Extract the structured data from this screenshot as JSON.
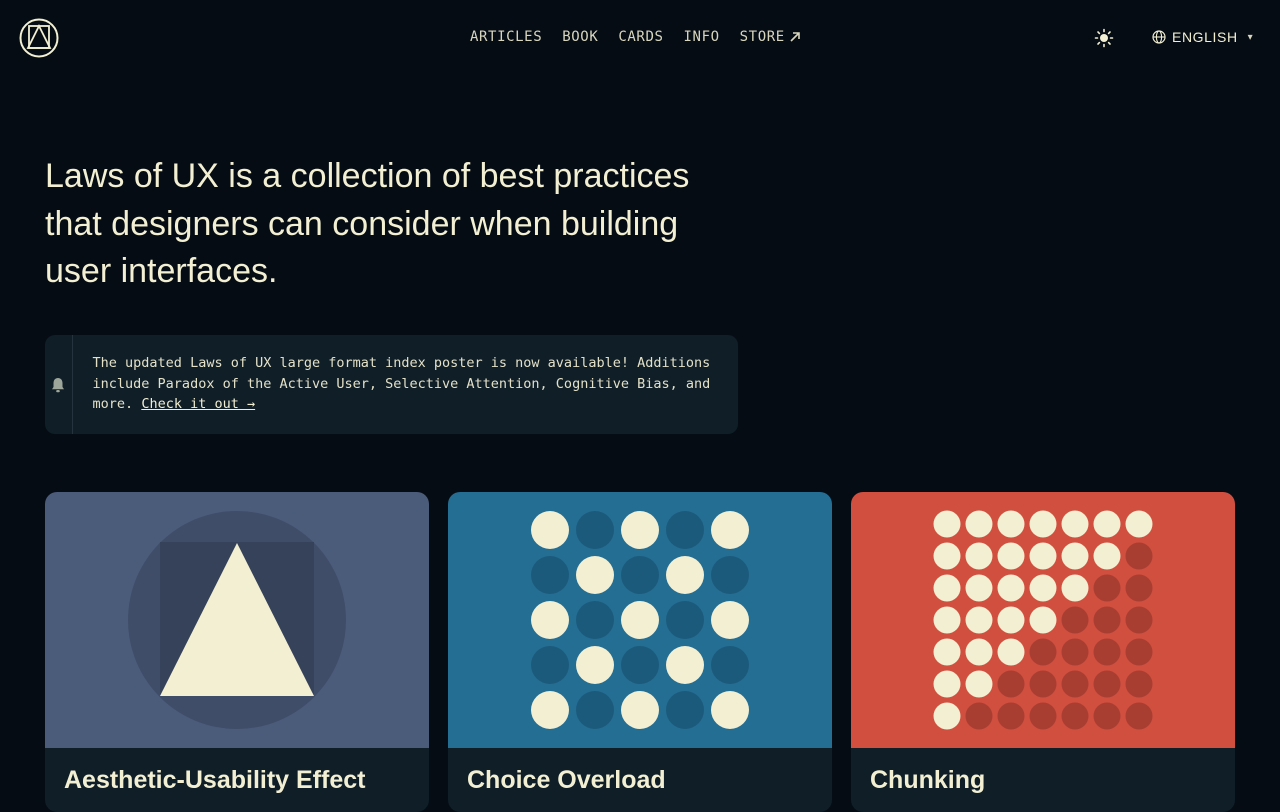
{
  "header": {
    "logo_icon": "laws-of-ux-logo-icon",
    "nav": [
      {
        "label": "ARTICLES"
      },
      {
        "label": "BOOK"
      },
      {
        "label": "CARDS"
      },
      {
        "label": "INFO"
      },
      {
        "label": "STORE",
        "icon": "external-link-arrow-icon"
      }
    ],
    "theme_icon": "sun-icon",
    "language": {
      "icon": "globe-icon",
      "label": "ENGLISH",
      "caret": "▾"
    }
  },
  "hero": {
    "text": "Laws of UX is a collection of best practices that designers can consider when building user interfaces."
  },
  "notice": {
    "icon": "bell-icon",
    "text": "The updated Laws of UX large format index poster is now available! Additions include Paradox of the Active User, Selective Attention, Cognitive Bias, and more. ",
    "link": "Check it out →"
  },
  "cards": [
    {
      "title": "Aesthetic-Usability Effect",
      "color": "#4b5b7a"
    },
    {
      "title": "Choice Overload",
      "color": "#246d93"
    },
    {
      "title": "Chunking",
      "color": "#d04f3f"
    }
  ],
  "colors": {
    "background": "#050c14",
    "text": "#f2efd3",
    "panel": "#0f1e27"
  }
}
